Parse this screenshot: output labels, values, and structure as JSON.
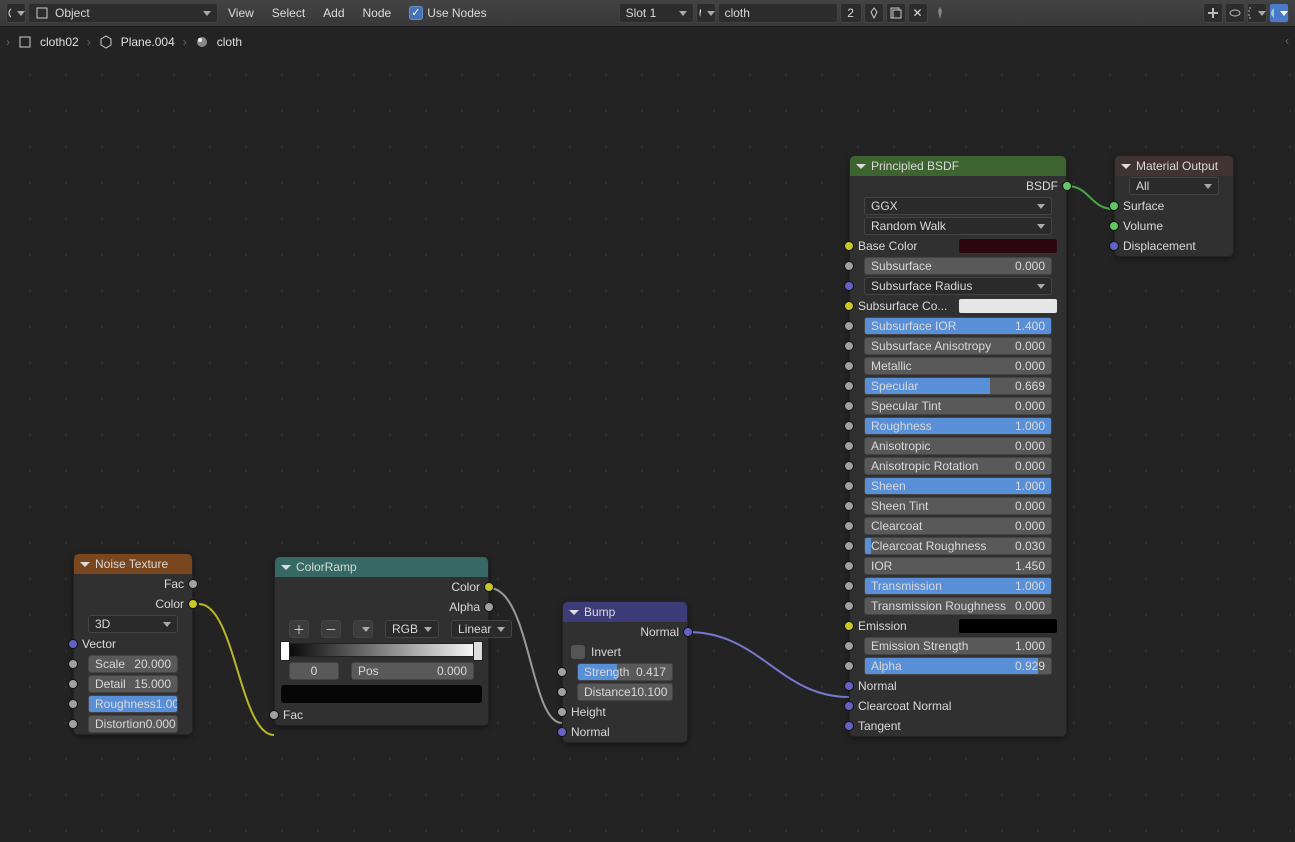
{
  "header": {
    "mode": "Object",
    "menus": [
      "View",
      "Select",
      "Add",
      "Node"
    ],
    "use_nodes": "Use Nodes",
    "slot": "Slot 1",
    "mat_name": "cloth",
    "users": "2"
  },
  "breadcrumb": {
    "scene": "cloth02",
    "object": "Plane.004",
    "material": "cloth"
  },
  "noise": {
    "title": "Noise Texture",
    "out_fac": "Fac",
    "out_color": "Color",
    "dim": "3D",
    "vector": "Vector",
    "params": [
      {
        "label": "Scale",
        "val": "20.000",
        "fill": 0
      },
      {
        "label": "Detail",
        "val": "15.000",
        "fill": 0
      },
      {
        "label": "Roughness",
        "val": "1.000",
        "fill": 100
      },
      {
        "label": "Distortion",
        "val": "0.000",
        "fill": 0
      }
    ]
  },
  "ramp": {
    "title": "ColorRamp",
    "out_color": "Color",
    "out_alpha": "Alpha",
    "interp1": "RGB",
    "interp2": "Linear",
    "idx": "0",
    "pos_lbl": "Pos",
    "pos_val": "0.000",
    "in_fac": "Fac"
  },
  "bump": {
    "title": "Bump",
    "out_normal": "Normal",
    "invert": "Invert",
    "strength": {
      "label": "Strength",
      "val": "0.417",
      "fill": 42
    },
    "distance": {
      "label": "Distance",
      "val": "10.100",
      "fill": 0
    },
    "height": "Height",
    "normal": "Normal"
  },
  "bsdf": {
    "title": "Principled BSDF",
    "out": "BSDF",
    "dist": "GGX",
    "sss": "Random Walk",
    "base": "Base Color",
    "base_col": "#2b0510",
    "ssc": "Subsurface Co...",
    "ssc_col": "#e6e6e6",
    "ssr": "Subsurface Radius",
    "emission": "Emission",
    "em_col": "#000000",
    "normal": "Normal",
    "cc_normal": "Clearcoat Normal",
    "tangent": "Tangent",
    "sliders": [
      {
        "label": "Subsurface",
        "val": "0.000",
        "fill": 0,
        "sock": "gy"
      },
      {
        "label": "Subsurface IOR",
        "val": "1.400",
        "fill": 100,
        "sock": "gy"
      },
      {
        "label": "Subsurface Anisotropy",
        "val": "0.000",
        "fill": 0,
        "sock": "gy"
      },
      {
        "label": "Metallic",
        "val": "0.000",
        "fill": 0,
        "sock": "gy"
      },
      {
        "label": "Specular",
        "val": "0.669",
        "fill": 67,
        "sock": "gy"
      },
      {
        "label": "Specular Tint",
        "val": "0.000",
        "fill": 0,
        "sock": "gy"
      },
      {
        "label": "Roughness",
        "val": "1.000",
        "fill": 100,
        "sock": "gy"
      },
      {
        "label": "Anisotropic",
        "val": "0.000",
        "fill": 0,
        "sock": "gy"
      },
      {
        "label": "Anisotropic Rotation",
        "val": "0.000",
        "fill": 0,
        "sock": "gy"
      },
      {
        "label": "Sheen",
        "val": "1.000",
        "fill": 100,
        "sock": "gy"
      },
      {
        "label": "Sheen Tint",
        "val": "0.000",
        "fill": 0,
        "sock": "gy"
      },
      {
        "label": "Clearcoat",
        "val": "0.000",
        "fill": 0,
        "sock": "gy"
      },
      {
        "label": "Clearcoat Roughness",
        "val": "0.030",
        "fill": 3,
        "sock": "gy"
      },
      {
        "label": "IOR",
        "val": "1.450",
        "fill": 0,
        "sock": "gy"
      },
      {
        "label": "Transmission",
        "val": "1.000",
        "fill": 100,
        "sock": "gy"
      },
      {
        "label": "Transmission Roughness",
        "val": "0.000",
        "fill": 0,
        "sock": "gy"
      },
      {
        "label": "Emission Strength",
        "val": "1.000",
        "fill": 0,
        "sock": "gy"
      },
      {
        "label": "Alpha",
        "val": "0.929",
        "fill": 93,
        "sock": "gy"
      }
    ]
  },
  "out": {
    "title": "Material Output",
    "target": "All",
    "surface": "Surface",
    "volume": "Volume",
    "disp": "Displacement"
  }
}
